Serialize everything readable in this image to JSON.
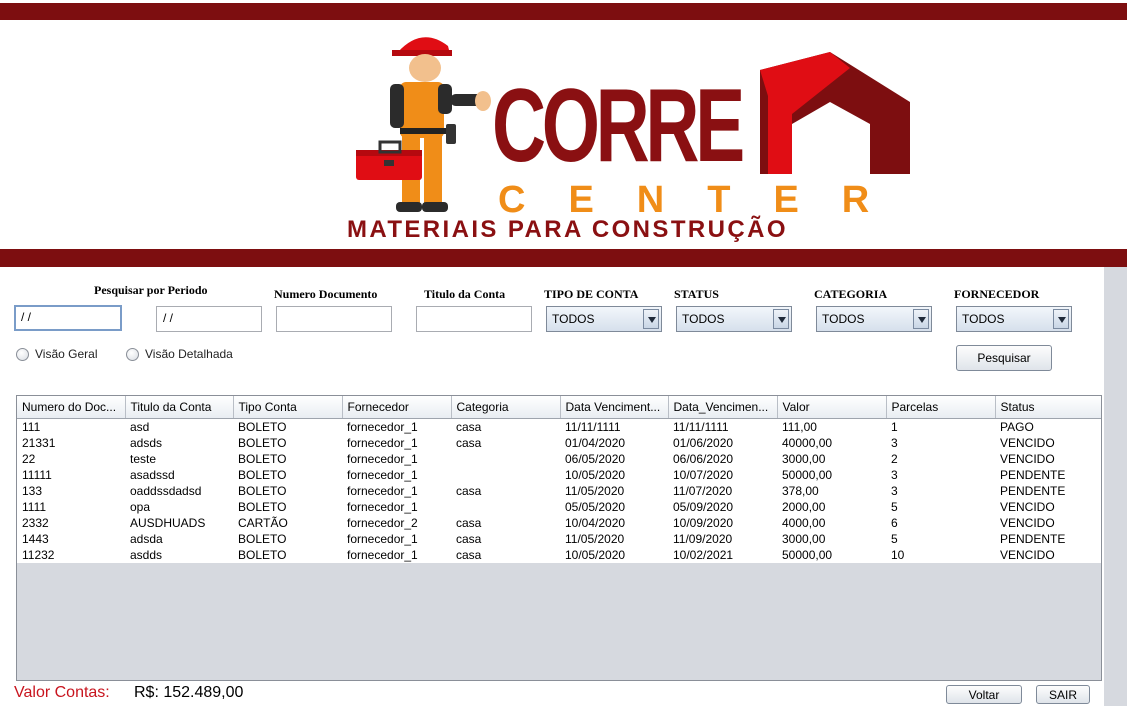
{
  "brand": {
    "name": "CORRE",
    "name2": "CENTER",
    "tagline": "MATERIAIS PARA CONSTRUÇÃO",
    "colors": {
      "dark_red": "#8a1012",
      "bright_red": "#e00d14",
      "orange": "#f08d18"
    }
  },
  "filters": {
    "period_label": "Pesquisar por Periodo",
    "date_start": "/ /",
    "date_end": "/ /",
    "doc_number_label": "Numero Documento",
    "doc_number_value": "",
    "title_label": "Titulo da Conta",
    "title_value": "",
    "account_type_label": "TIPO DE CONTA",
    "account_type_value": "TODOS",
    "status_label": "STATUS",
    "status_value": "TODOS",
    "category_label": "CATEGORIA",
    "category_value": "TODOS",
    "supplier_label": "FORNECEDOR",
    "supplier_value": "TODOS",
    "view_general": "Visão Geral",
    "view_detailed": "Visão Detalhada",
    "search_button": "Pesquisar"
  },
  "table": {
    "columns": [
      "Numero do Doc...",
      "Titulo da Conta",
      "Tipo Conta",
      "Fornecedor",
      "Categoria",
      "Data Venciment...",
      "Data_Vencimen...",
      "Valor",
      "Parcelas",
      "Status"
    ],
    "rows": [
      [
        "111",
        "asd",
        "BOLETO",
        "fornecedor_1",
        "casa",
        "11/11/1111",
        "11/11/1111",
        "111,00",
        "1",
        "PAGO"
      ],
      [
        "21331",
        "adsds",
        "BOLETO",
        "fornecedor_1",
        "casa",
        "01/04/2020",
        "01/06/2020",
        "40000,00",
        "3",
        "VENCIDO"
      ],
      [
        "22",
        "teste",
        "BOLETO",
        "fornecedor_1",
        "",
        "06/05/2020",
        "06/06/2020",
        "3000,00",
        "2",
        "VENCIDO"
      ],
      [
        "11111",
        "asadssd",
        "BOLETO",
        "fornecedor_1",
        "",
        "10/05/2020",
        "10/07/2020",
        "50000,00",
        "3",
        "PENDENTE"
      ],
      [
        "133",
        "oaddssdadsd",
        "BOLETO",
        "fornecedor_1",
        "casa",
        "11/05/2020",
        "11/07/2020",
        "378,00",
        "3",
        "PENDENTE"
      ],
      [
        "1111",
        "opa",
        "BOLETO",
        "fornecedor_1",
        "",
        "05/05/2020",
        "05/09/2020",
        "2000,00",
        "5",
        "VENCIDO"
      ],
      [
        "2332",
        "AUSDHUADS",
        "CARTÃO",
        "fornecedor_2",
        "casa",
        "10/04/2020",
        "10/09/2020",
        "4000,00",
        "6",
        "VENCIDO"
      ],
      [
        "1443",
        "adsda",
        "BOLETO",
        "fornecedor_1",
        "casa",
        "11/05/2020",
        "11/09/2020",
        "3000,00",
        "5",
        "PENDENTE"
      ],
      [
        "11232",
        "asdds",
        "BOLETO",
        "fornecedor_1",
        "casa",
        "10/05/2020",
        "10/02/2021",
        "50000,00",
        "10",
        "VENCIDO"
      ]
    ]
  },
  "footer": {
    "total_label": "Valor Contas:",
    "total_value": "R$: 152.489,00",
    "back_button": "Voltar",
    "exit_button": "SAIR"
  }
}
